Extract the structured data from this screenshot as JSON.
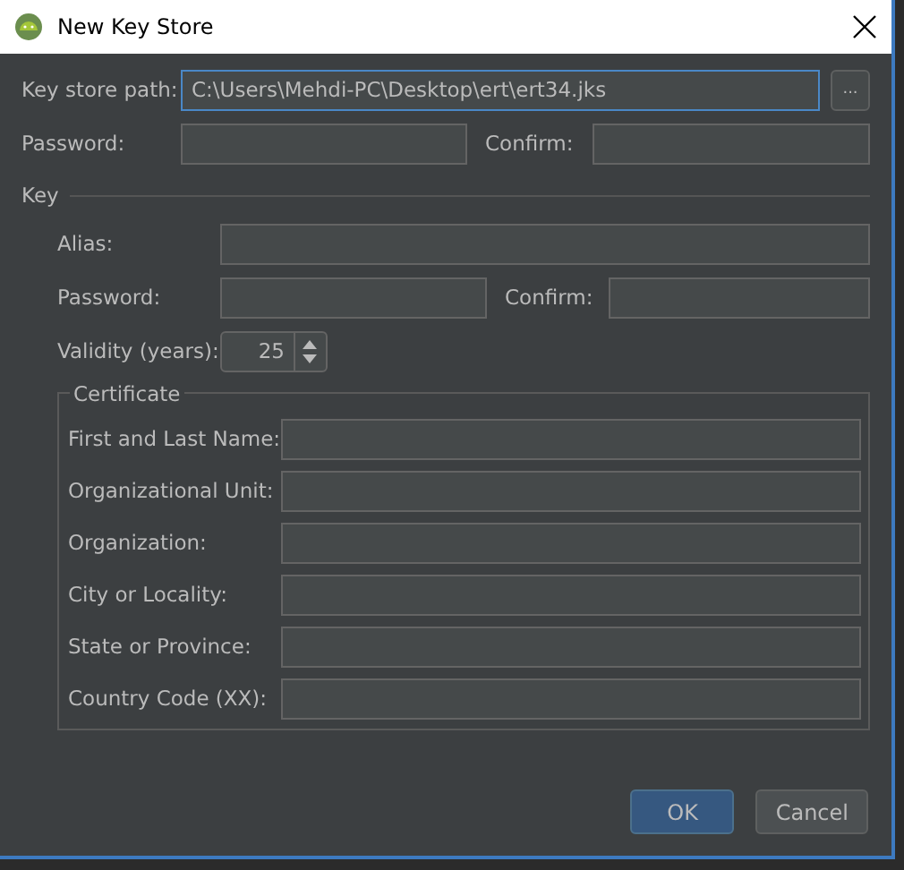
{
  "window": {
    "title": "New Key Store"
  },
  "key_store_path": {
    "label": "Key store path:",
    "value": "C:\\Users\\Mehdi-PC\\Desktop\\ert\\ert34.jks",
    "focused": true,
    "browse": "..."
  },
  "password": {
    "label": "Password:"
  },
  "confirm": {
    "label": "Confirm:"
  },
  "key": {
    "title": "Key",
    "alias": {
      "label": "Alias:"
    },
    "password": {
      "label": "Password:"
    },
    "confirm": {
      "label": "Confirm:"
    },
    "validity": {
      "label": "Validity (years):",
      "value": "25"
    },
    "certificate": {
      "title": "Certificate",
      "fields": [
        {
          "label": "First and Last Name:"
        },
        {
          "label": "Organizational Unit:"
        },
        {
          "label": "Organization:"
        },
        {
          "label": "City or Locality:"
        },
        {
          "label": "State or Province:"
        },
        {
          "label": "Country Code (XX):"
        }
      ]
    }
  },
  "buttons": [
    {
      "label": "OK",
      "kind": "primary"
    },
    {
      "label": "Cancel",
      "kind": "secondary"
    }
  ]
}
